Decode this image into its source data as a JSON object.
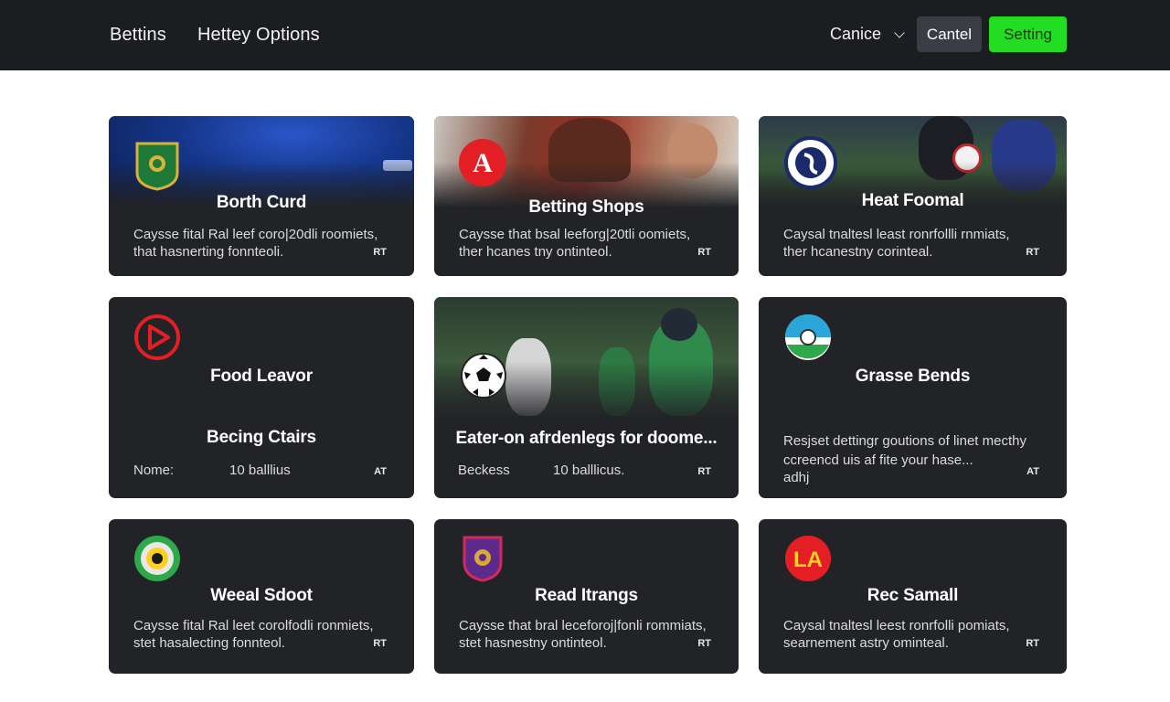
{
  "header": {
    "nav": [
      "Bettins",
      "Hettey Options"
    ],
    "dropdown_label": "Canice",
    "cancel_label": "Cantel",
    "setting_label": "Setting"
  },
  "colors": {
    "topbar": "#1c1d20",
    "card": "#222327",
    "accent_green": "#22dd22"
  },
  "cards": [
    {
      "title": "Borth Curd",
      "desc1": "Caysse fital Ral leef coro|20dli roomiets,",
      "desc2": "that hasnerting fonnteoli.",
      "tag": "RT",
      "logo": "green-crest-icon"
    },
    {
      "title": "Betting Shops",
      "desc1": "Caysse that bsal leeforg|20tli oomiets,",
      "desc2": "ther hcanes tny ontinteol.",
      "tag": "RT",
      "logo": "red-a-badge-icon"
    },
    {
      "title": "Heat Foomal",
      "desc1": "Caysal tnaltesl least ronrfollli rnmiats,",
      "desc2": "ther hcanestny corinteal.",
      "tag": "RT",
      "logo": "club-crest-icon"
    },
    {
      "title": "Food Leavor",
      "subtitle": "Becing Ctairs",
      "stat_label": "Nome:",
      "stat_value": "10 balllius",
      "tag": "AT",
      "logo": "play-circle-icon"
    },
    {
      "title": "Eater-on afrdenlegs for doome...",
      "stat_label": "Beckess",
      "stat_value": "10 balllicus.",
      "tag": "RT",
      "logo": "soccer-ball-icon"
    },
    {
      "title": "Grasse Bends",
      "desc1": "Resjset dettingr goutions of linet mecthy",
      "desc2": "ccreencd uis af fite your hase...",
      "desc3": "adhj",
      "tag": "AT",
      "logo": "globe-badge-icon"
    },
    {
      "title": "Weeal Sdoot",
      "desc1": "Caysse fital Ral leet corolfodli ronmiets,",
      "desc2": "stet hasalecting fonnteol.",
      "tag": "RT",
      "logo": "green-ring-badge-icon"
    },
    {
      "title": "Read Itrangs",
      "desc1": "Caysse that bral leceforoj|fonli rommiats,",
      "desc2": "stet hasnestny ontinteol.",
      "tag": "RT",
      "logo": "purple-shield-icon"
    },
    {
      "title": "Rec Samall",
      "desc1": "Caysal tnaltesl leest ronrfolli pomiats,",
      "desc2": "searnement astry ominteal.",
      "tag": "RT",
      "logo": "la-red-badge-icon"
    }
  ]
}
